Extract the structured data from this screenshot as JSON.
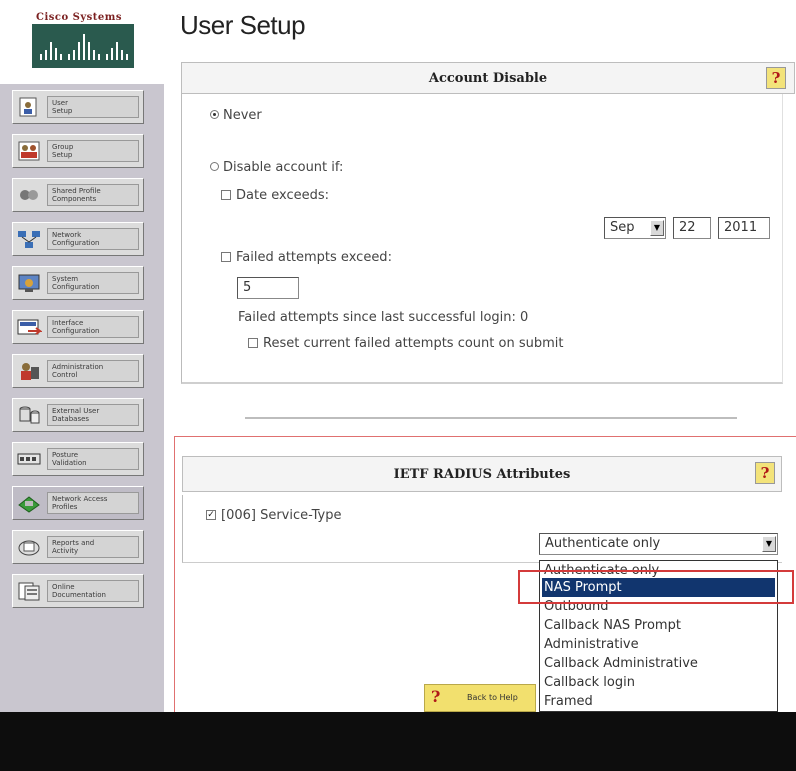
{
  "logo": {
    "text": "Cisco Systems"
  },
  "nav": {
    "items": [
      {
        "label": "User\nSetup"
      },
      {
        "label": "Group\nSetup"
      },
      {
        "label": "Shared Profile\nComponents"
      },
      {
        "label": "Network\nConfiguration"
      },
      {
        "label": "System\nConfiguration"
      },
      {
        "label": "Interface\nConfiguration"
      },
      {
        "label": "Administration\nControl"
      },
      {
        "label": "External User\nDatabases"
      },
      {
        "label": "Posture\nValidation"
      },
      {
        "label": "Network Access\nProfiles"
      },
      {
        "label": "Reports and\nActivity"
      },
      {
        "label": "Online\nDocumentation"
      }
    ]
  },
  "page": {
    "title": "User Setup"
  },
  "account_disable": {
    "heading": "Account Disable",
    "help": "?",
    "never_label": "Never",
    "disable_if_label": "Disable account if:",
    "date_exceeds_label": "Date exceeds:",
    "month": "Sep",
    "day": "22",
    "year": "2011",
    "failed_attempts_label": "Failed attempts exceed:",
    "failed_attempts_value": "5",
    "since_last_label": "Failed attempts since last successful login: 0",
    "reset_label": "Reset current failed attempts count on submit"
  },
  "radius": {
    "heading": "IETF RADIUS Attributes",
    "help": "?",
    "service_type_label": "[006] Service-Type",
    "service_type_value": "Authenticate only",
    "options": [
      "Authenticate only",
      "NAS Prompt",
      "Outbound",
      "Callback NAS Prompt",
      "Administrative",
      "Callback Administrative",
      "Callback login",
      "Framed"
    ],
    "selected_option": "NAS Prompt"
  },
  "back_to_help": {
    "icon": "?",
    "label": "Back to Help"
  },
  "colors": {
    "nav_bg": "#c9c6cf",
    "selection": "#11356e",
    "highlight": "#d43b3b",
    "help_bg": "#f3e37a"
  }
}
